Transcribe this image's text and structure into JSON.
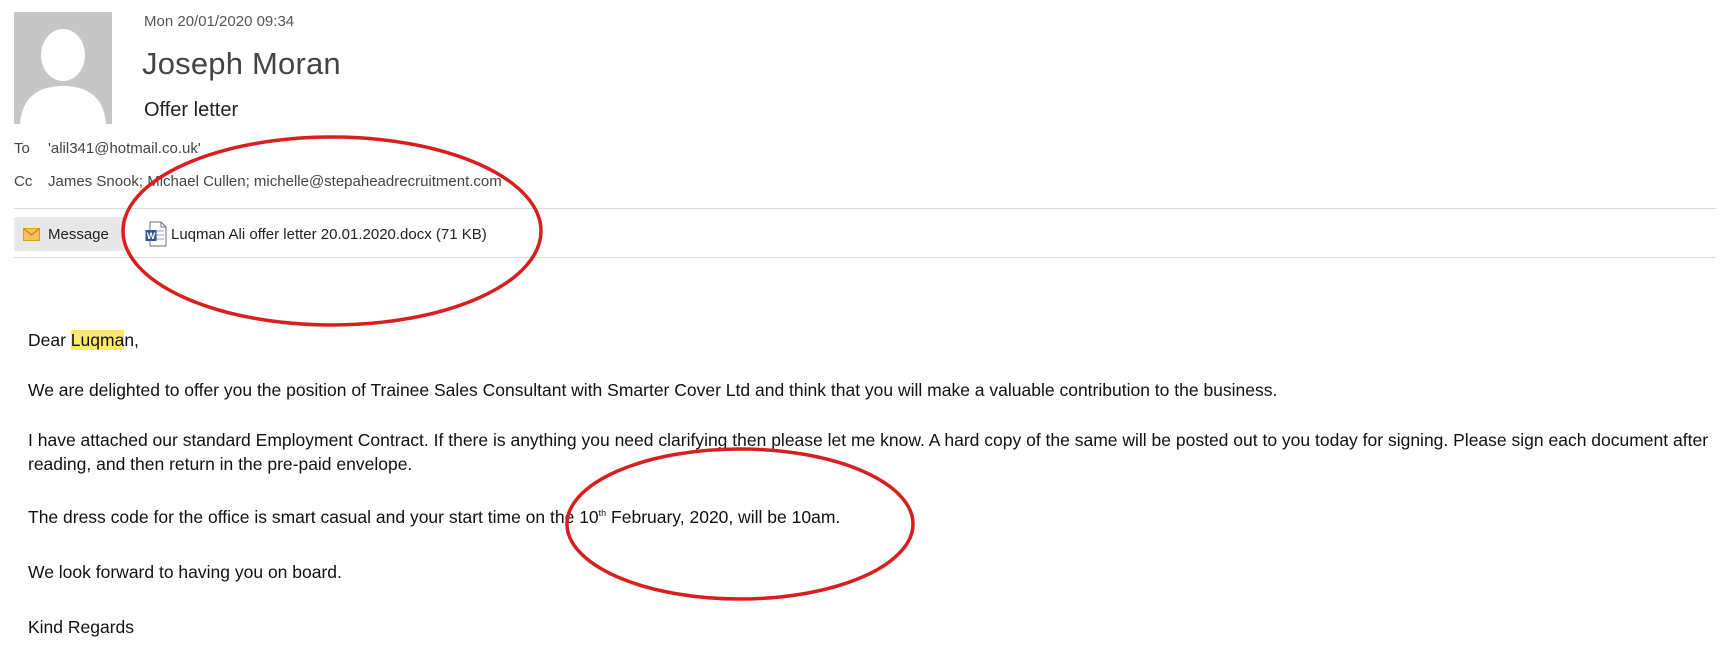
{
  "header": {
    "date": "Mon 20/01/2020 09:34",
    "sender": "Joseph Moran",
    "subject": "Offer letter",
    "to_label": "To",
    "to_value": "'alil341@hotmail.co.uk'",
    "cc_label": "Cc",
    "cc_value": "James Snook; Michael Cullen; michelle@stepaheadrecruitment.com"
  },
  "toolbar": {
    "message_tab": "Message",
    "attachment": "Luqman Ali offer letter 20.01.2020.docx (71 KB)"
  },
  "body": {
    "greeting_prefix": "Dear ",
    "greeting_highlight": "Luqma",
    "greeting_suffix": "n,",
    "p1": "We are delighted to offer you the position of Trainee Sales Consultant with Smarter Cover Ltd and think that you will make a valuable contribution to the business.",
    "p2": "I have attached our standard Employment Contract. If there is anything you need clarifying then please let me know. A hard copy of the same will be posted out to you today for signing. Please sign each document after reading, and then return in the pre-paid envelope.",
    "p3_prefix": "The dress code for the office is smart casual and your start time on the 10",
    "p3_sup": "th",
    "p3_suffix": " February, 2020, will be 10am.",
    "p4": "We look forward to having you on board.",
    "closing": "Kind Regards"
  },
  "colors": {
    "highlight": "#fde969",
    "annotation": "#d81e1e",
    "avatar_bg": "#c6c6c6",
    "tab_bg": "#e7e7e7"
  }
}
